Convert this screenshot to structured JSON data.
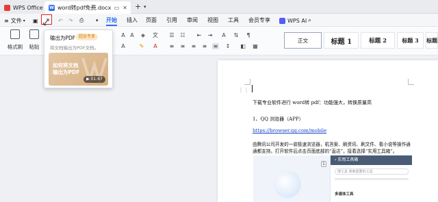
{
  "titlebar": {
    "app_tab": "WPS Office",
    "doc_tab": "word转pdf免费.docx",
    "doc_icon_letter": "W",
    "add_tab": "+"
  },
  "menubar": {
    "file": "文件",
    "tabs": [
      "开始",
      "插入",
      "页面",
      "引用",
      "审阅",
      "视图",
      "工具",
      "会员专享"
    ],
    "ai": "WPS AI",
    "search_icon": "search-icon"
  },
  "ribbon": {
    "format_painter": "格式刷",
    "paste": "粘贴",
    "styles": [
      "正文",
      "标题 1",
      "标题 2",
      "标题 3",
      "标题"
    ]
  },
  "popup": {
    "title": "输出为PDF",
    "badge": "超会专享",
    "subtitle": "将文档输出为PDF文档。",
    "thumb_text": "如何将文档\n输出为PDF",
    "duration": "01:47"
  },
  "document": {
    "line1": "下载专业软件进行 word转 pdf：功能强大，转换质量高",
    "line2": "1、QQ 浏览器（APP）",
    "link": "https://browser.qq.com/mobile",
    "para1": "由腾讯公司开发的一款极速浏览器，机答案、刷资讯、刷文件、看小说等操作通",
    "para2": "通都支持。打开软件后点击页面底部的“直达”，接着选择“实用工具箱”。",
    "embed_title": "实用工具箱",
    "embed_search": "搜工具 搜索需要的工具",
    "embed_section": "多媒体工具",
    "embed_num": "1"
  },
  "colors": {
    "accent": "#2f6df5",
    "highlight": "#e02020",
    "badge": "#d97a10"
  }
}
